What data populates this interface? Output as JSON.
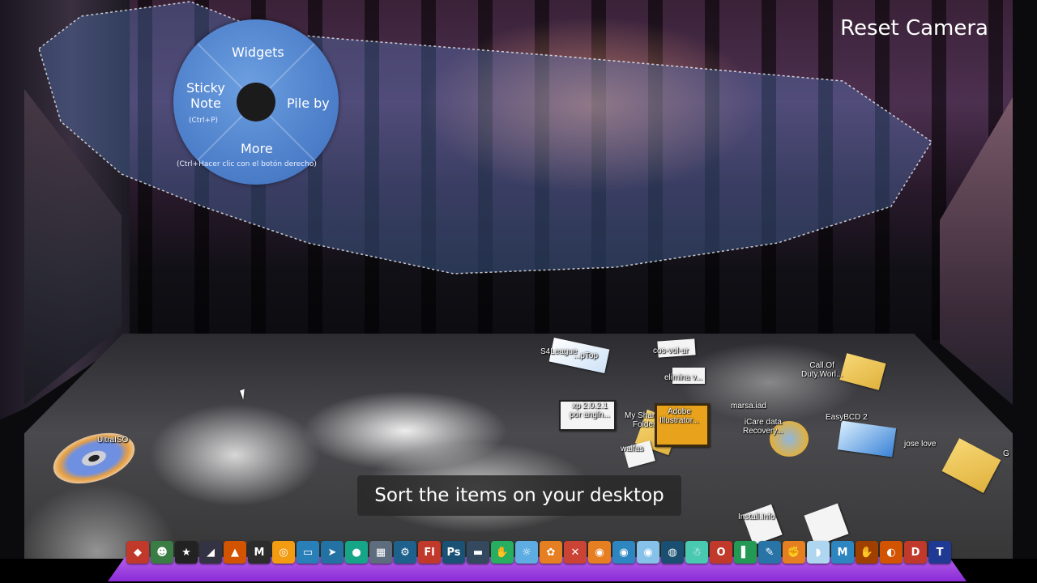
{
  "reset_camera": "Reset Camera",
  "pie_menu": {
    "top": "Widgets",
    "left_line1": "Sticky",
    "left_line2": "Note",
    "left_hint": "(Ctrl+P)",
    "right": "Pile by",
    "bottom": "More",
    "bottom_hint": "(Ctrl+Hacer clic con el botón derecho)"
  },
  "tooltip": "Sort the items on your desktop",
  "desktop_items": {
    "ultraiso": "UltraISO",
    "s4league_1": "S4League",
    "s4league_2": "...pTop",
    "cosvolur": "cos-vol-ur",
    "elimina": "elimina v...",
    "callofduty_1": "Call.Of",
    "callofduty_2": "Duty.Worl...",
    "xp_1": "xp 2.0.2.1",
    "xp_2": "por angln...",
    "shared_1": "My Shared",
    "shared_2": "Folder",
    "adobe_1": "Adobe",
    "adobe_2": "Illustrator...",
    "marsaiad": "marsa.iad",
    "icare_1": "iCare data",
    "icare_2": "Recovery...",
    "easybcd": "EasyBCD 2",
    "walfas": "walfas",
    "jose": "jose love",
    "install": "Install.Info",
    "edge": "G"
  },
  "dock_icons": [
    {
      "name": "icon-1",
      "glyph": "◆",
      "color": "#c0392b"
    },
    {
      "name": "icon-2",
      "glyph": "☻",
      "color": "#3a7d44"
    },
    {
      "name": "icon-3",
      "glyph": "★",
      "color": "#222222"
    },
    {
      "name": "icon-4",
      "glyph": "◢",
      "color": "#333344"
    },
    {
      "name": "icon-5",
      "glyph": "▲",
      "color": "#d35400"
    },
    {
      "name": "icon-6",
      "glyph": "M",
      "color": "#2c2c2c"
    },
    {
      "name": "icon-7",
      "glyph": "◎",
      "color": "#f39c12"
    },
    {
      "name": "icon-8",
      "glyph": "▭",
      "color": "#2980b9"
    },
    {
      "name": "icon-9",
      "glyph": "➤",
      "color": "#2471a3"
    },
    {
      "name": "icon-10",
      "glyph": "●",
      "color": "#17a589"
    },
    {
      "name": "icon-11",
      "glyph": "▦",
      "color": "#5d6d7e"
    },
    {
      "name": "icon-12",
      "glyph": "⚙",
      "color": "#1f618d"
    },
    {
      "name": "icon-13",
      "glyph": "Fl",
      "color": "#c0392b"
    },
    {
      "name": "icon-14",
      "glyph": "Ps",
      "color": "#1a5276"
    },
    {
      "name": "icon-15",
      "glyph": "▬",
      "color": "#34495e"
    },
    {
      "name": "icon-16",
      "glyph": "✋",
      "color": "#27ae60"
    },
    {
      "name": "icon-17",
      "glyph": "☼",
      "color": "#5dade2"
    },
    {
      "name": "icon-18",
      "glyph": "✿",
      "color": "#e67e22"
    },
    {
      "name": "icon-19",
      "glyph": "✕",
      "color": "#cb4335"
    },
    {
      "name": "icon-20",
      "glyph": "◉",
      "color": "#e67e22"
    },
    {
      "name": "icon-21",
      "glyph": "◉",
      "color": "#2e86c1"
    },
    {
      "name": "icon-22",
      "glyph": "◉",
      "color": "#85c1e9"
    },
    {
      "name": "icon-23",
      "glyph": "◍",
      "color": "#1b4f72"
    },
    {
      "name": "icon-24",
      "glyph": "☃",
      "color": "#48c9b0"
    },
    {
      "name": "icon-25",
      "glyph": "O",
      "color": "#c0392b"
    },
    {
      "name": "icon-26",
      "glyph": "▌",
      "color": "#229954"
    },
    {
      "name": "icon-27",
      "glyph": "✎",
      "color": "#2874a6"
    },
    {
      "name": "icon-28",
      "glyph": "✊",
      "color": "#e67e22"
    },
    {
      "name": "icon-29",
      "glyph": "◗",
      "color": "#aed6f1"
    },
    {
      "name": "icon-30",
      "glyph": "M",
      "color": "#2e86c1"
    },
    {
      "name": "icon-31",
      "glyph": "✋",
      "color": "#a04000"
    },
    {
      "name": "icon-32",
      "glyph": "◐",
      "color": "#d35400"
    },
    {
      "name": "icon-33",
      "glyph": "D",
      "color": "#c0392b"
    },
    {
      "name": "icon-34",
      "glyph": "T",
      "color": "#1f3a93"
    }
  ]
}
